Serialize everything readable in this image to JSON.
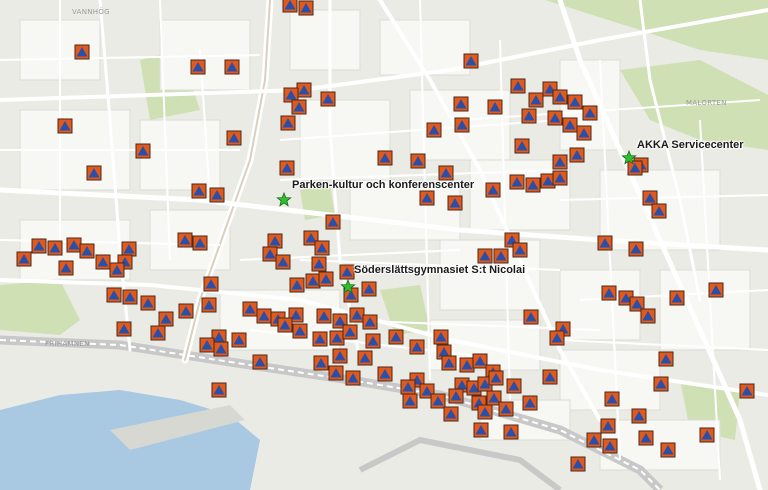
{
  "map": {
    "place_labels": [
      "VANNHÖG",
      "MALORTEN",
      "FRIHAMNEN"
    ],
    "points_of_interest": [
      "Parken-kultur och konferenscenter",
      "Söderslättsgymnasiet S:t Nicolai",
      "AKKA Servicecenter"
    ],
    "shelter_marker": {
      "icon": "civil-defence-triangle-icon",
      "fill": "#e05a1e",
      "triangle": "#2a4fa8",
      "border": "#4a2a1a"
    },
    "poi_marker": {
      "icon": "star-icon",
      "fill": "#2ec02e"
    },
    "colors": {
      "land": "#ebebe6",
      "block": "#f7f7f4",
      "park": "#cfe0b4",
      "water": "#a9c9e3",
      "road": "#ffffff",
      "railway": "#c8c8c8"
    }
  }
}
